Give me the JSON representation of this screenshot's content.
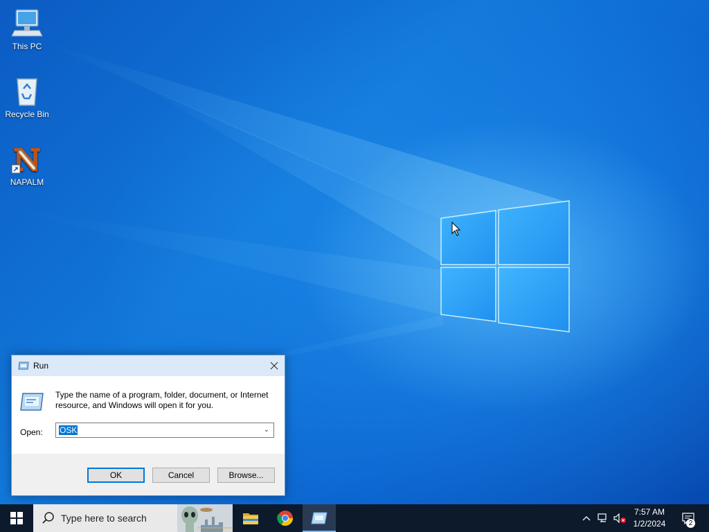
{
  "desktop": {
    "icons": [
      {
        "label": "This PC",
        "icon": "computer-icon"
      },
      {
        "label": "Recycle Bin",
        "icon": "recycle-bin-icon"
      },
      {
        "label": "NAPALM",
        "icon": "napalm-app-icon",
        "glyph": "N"
      }
    ]
  },
  "run_dialog": {
    "title": "Run",
    "description": "Type the name of a program, folder, document, or Internet resource, and Windows will open it for you.",
    "open_label": "Open:",
    "open_value": "OSK",
    "buttons": {
      "ok": "OK",
      "cancel": "Cancel",
      "browse": "Browse..."
    }
  },
  "taskbar": {
    "search_placeholder": "Type here to search",
    "apps": [
      {
        "name": "File Explorer",
        "icon": "file-explorer-icon"
      },
      {
        "name": "Google Chrome",
        "icon": "chrome-icon"
      },
      {
        "name": "Run",
        "icon": "run-icon",
        "active": true
      }
    ],
    "clock": {
      "time": "7:57 AM",
      "date": "1/2/2024"
    },
    "notification_count": "2"
  },
  "colors": {
    "accent": "#0078d7",
    "taskbar": "#0c1a2c",
    "desktop": "#0b63cf"
  }
}
